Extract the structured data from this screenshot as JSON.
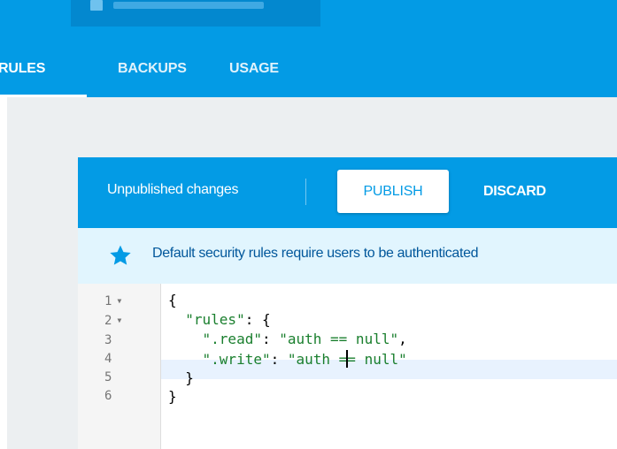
{
  "header": {
    "project_name": ""
  },
  "tabs": [
    {
      "label": "RULES",
      "active": true
    },
    {
      "label": "BACKUPS",
      "active": false
    },
    {
      "label": "USAGE",
      "active": false
    }
  ],
  "rules_card": {
    "status_text": "Unpublished changes",
    "publish_label": "PUBLISH",
    "discard_label": "DISCARD",
    "notice_text": "Default security rules require users to be authenticated",
    "notice_icon": "star-icon"
  },
  "editor": {
    "line_numbers": [
      "1",
      "2",
      "3",
      "4",
      "5",
      "6"
    ],
    "foldable_lines": [
      1,
      2
    ],
    "active_line": 4,
    "code": {
      "line1": "{",
      "line2_key": "\"rules\"",
      "line2_rest": ": {",
      "line3_key": "\".read\"",
      "line3_sep": ": ",
      "line3_val": "\"auth == null\"",
      "line3_end": ",",
      "line4_key": "\".write\"",
      "line4_sep": ": ",
      "line4_val_a": "\"auth =",
      "line4_val_b": "= null\"",
      "line5": "}",
      "line6": "}"
    }
  },
  "colors": {
    "primary": "#039be5",
    "notice_bg": "#e1f5fe",
    "notice_text": "#01579b",
    "string": "#1a7f2e"
  }
}
